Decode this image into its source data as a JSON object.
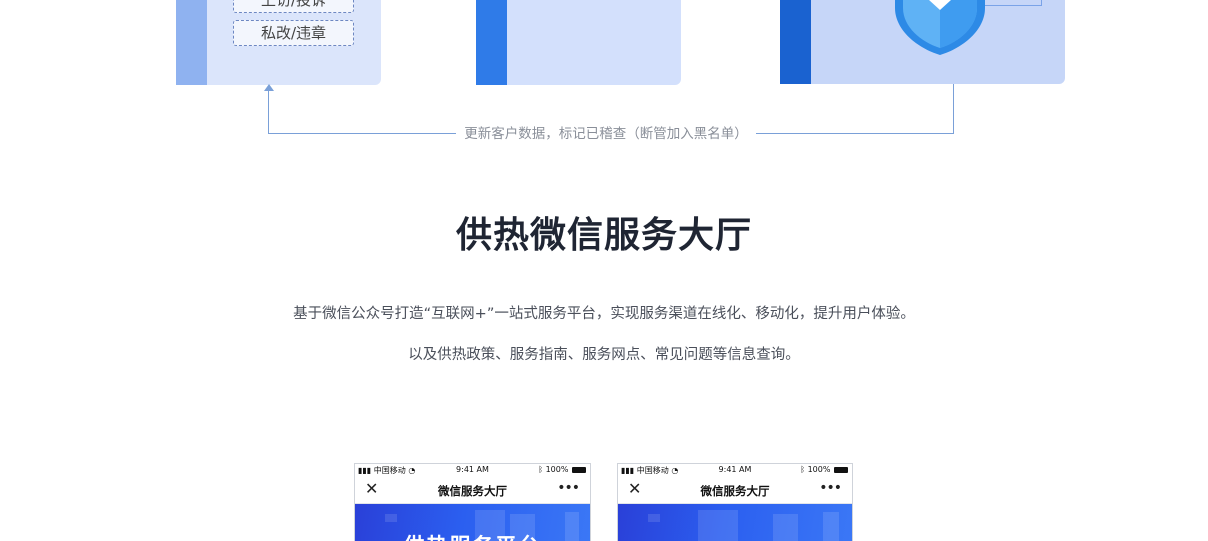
{
  "diagram": {
    "tags": [
      "上访/投诉",
      "私改/违章"
    ],
    "connector_label": "更新客户数据，标记已稽查（断管加入黑名单）"
  },
  "section": {
    "title": "供热微信服务大厅",
    "description_line1": "基于微信公众号打造“互联网+”一站式服务平台，实现服务渠道在线化、移动化，提升用户体验。",
    "description_line2": "以及供热政策、服务指南、服务网点、常见问题等信息查询。"
  },
  "phones": [
    {
      "carrier": "中国移动",
      "time": "9:41 AM",
      "battery": "100%",
      "nav_title": "微信服务大厅",
      "banner_text": "供热服务平台"
    },
    {
      "carrier": "中国移动",
      "time": "9:41 AM",
      "battery": "100%",
      "nav_title": "微信服务大厅",
      "banner_text": ""
    }
  ],
  "icons": {
    "close": "close-icon",
    "more": "more-icon",
    "shield": "shield-icon",
    "signal": "signal-icon",
    "wifi": "wifi-icon",
    "bluetooth": "bluetooth-icon",
    "battery": "battery-icon"
  },
  "colors": {
    "accent": "#2f7be8",
    "banner": "#2b5ff0",
    "title": "#1f2533"
  }
}
